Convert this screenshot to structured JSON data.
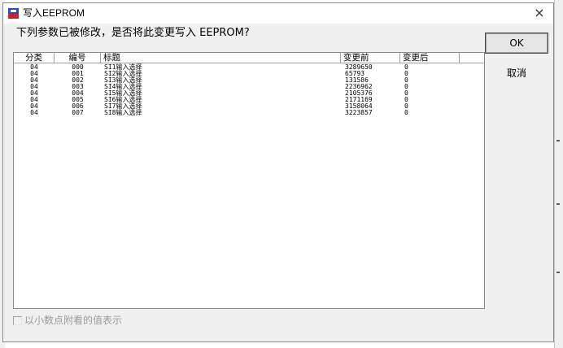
{
  "window": {
    "title": "写入EEPROM",
    "close_glyph": "×",
    "icon": "app-icon"
  },
  "prompt": "下列参数已被修改，是否将此变更写入 EEPROM?",
  "table": {
    "headers": [
      "分类",
      "编号",
      "标题",
      "变更前",
      "变更后"
    ],
    "rows": [
      [
        "04",
        "000",
        "SI1输入选择",
        "3289650",
        "0"
      ],
      [
        "04",
        "001",
        "SI2输入选择",
        "65793",
        "0"
      ],
      [
        "04",
        "002",
        "SI3输入选择",
        "131586",
        "0"
      ],
      [
        "04",
        "003",
        "SI4输入选择",
        "2236962",
        "0"
      ],
      [
        "04",
        "004",
        "SI5输入选择",
        "2105376",
        "0"
      ],
      [
        "04",
        "005",
        "SI6输入选择",
        "2171169",
        "0"
      ],
      [
        "04",
        "006",
        "SI7输入选择",
        "3158064",
        "0"
      ],
      [
        "04",
        "007",
        "SI8输入选择",
        "3223857",
        "0"
      ]
    ]
  },
  "buttons": {
    "ok": "OK",
    "cancel": "取消"
  },
  "checkbox": {
    "label": "以小数点附看的值表示",
    "checked": false,
    "enabled": false
  },
  "colors": {
    "dialog_bg": "#f0f0f0",
    "list_bg": "#ffffff",
    "disabled_text": "#9a9a9a",
    "icon_blue": "#1a4fd0",
    "icon_red": "#d42020"
  }
}
